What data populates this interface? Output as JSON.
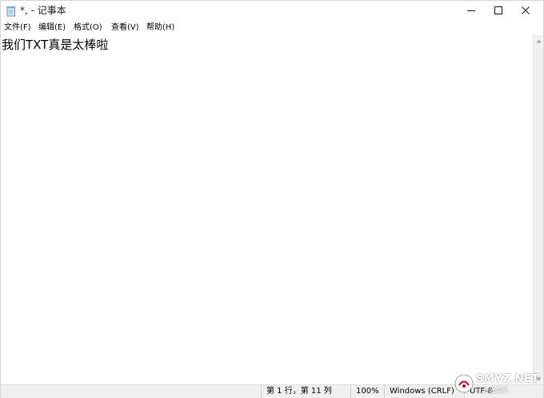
{
  "window": {
    "title": "*, - 记事本"
  },
  "menu": {
    "items": [
      {
        "label": "文件(F)"
      },
      {
        "label": "编辑(E)"
      },
      {
        "label": "格式(O)"
      },
      {
        "label": "查看(V)"
      },
      {
        "label": "帮助(H)"
      }
    ]
  },
  "editor": {
    "content": "我们TXT真是太棒啦"
  },
  "status": {
    "position": "第 1 行，第 11 列",
    "zoom": "100%",
    "line_ending": "Windows (CRLF)",
    "encoding": "UTF-8"
  },
  "watermark": {
    "text": "SMYZ.NET",
    "sub": "什么值得买"
  },
  "icons": {
    "app": "notepad-icon",
    "minimize": "minimize-icon",
    "maximize": "maximize-icon",
    "close": "close-icon"
  },
  "colors": {
    "background": "#ffffff",
    "statusbar": "#f0f0f0",
    "scrollbar": "#f0f0f0"
  }
}
